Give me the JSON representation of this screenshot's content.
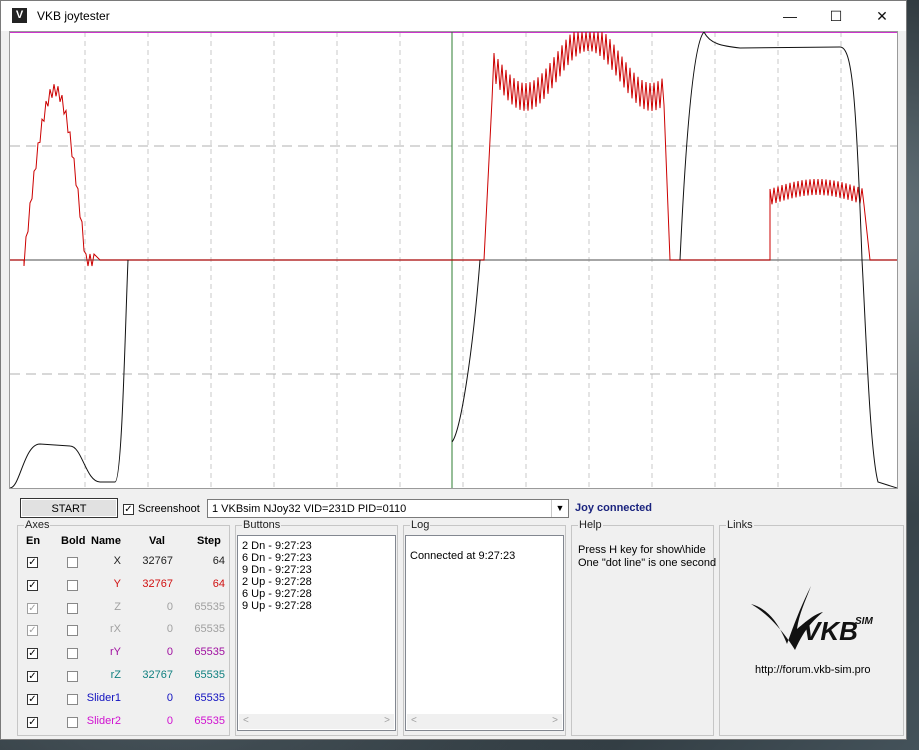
{
  "window": {
    "title": "VKB joytester",
    "minimize_glyph": "—",
    "maximize_glyph": "☐",
    "close_glyph": "✕",
    "icon": "vkb-logo-icon"
  },
  "toolbar": {
    "start_label": "START",
    "screenshot_label": "Screenshoot",
    "screenshot_checked": true,
    "device": "1 VKBsim NJoy32  VID=231D PID=0110",
    "status": "Joy connected",
    "status_color": "#1a237e"
  },
  "axes": {
    "group_title": "Axes",
    "headers": {
      "en": "En",
      "bold": "Bold",
      "name": "Name",
      "val": "Val",
      "step": "Step"
    },
    "rows": [
      {
        "name": "X",
        "val": "32767",
        "step": "64",
        "color": "#222222",
        "en": true,
        "en_dim": false,
        "bold": false
      },
      {
        "name": "Y",
        "val": "32767",
        "step": "64",
        "color": "#d01010",
        "en": true,
        "en_dim": false,
        "bold": false
      },
      {
        "name": "Z",
        "val": "0",
        "step": "65535",
        "color": "#a0a0a0",
        "en": true,
        "en_dim": true,
        "bold": false
      },
      {
        "name": "rX",
        "val": "0",
        "step": "65535",
        "color": "#a0a0a0",
        "en": true,
        "en_dim": true,
        "bold": false
      },
      {
        "name": "rY",
        "val": "0",
        "step": "65535",
        "color": "#a010a0",
        "en": true,
        "en_dim": false,
        "bold": false
      },
      {
        "name": "rZ",
        "val": "32767",
        "step": "65535",
        "color": "#108080",
        "en": true,
        "en_dim": false,
        "bold": false
      },
      {
        "name": "Slider1",
        "val": "0",
        "step": "65535",
        "color": "#1010c0",
        "en": true,
        "en_dim": false,
        "bold": false
      },
      {
        "name": "Slider2",
        "val": "0",
        "step": "65535",
        "color": "#d010d0",
        "en": true,
        "en_dim": false,
        "bold": false
      }
    ]
  },
  "buttons": {
    "group_title": "Buttons",
    "lines": [
      "2 Dn - 9:27:23",
      "6 Dn - 9:27:23",
      "9 Dn - 9:27:23",
      "2 Up - 9:27:28",
      "6 Up - 9:27:28",
      "9 Up - 9:27:28"
    ]
  },
  "log": {
    "group_title": "Log",
    "lines": [
      "Connected at 9:27:23"
    ]
  },
  "help": {
    "group_title": "Help",
    "lines": [
      "Press H key for show\\hide",
      "One \"dot line\" is one second"
    ]
  },
  "links": {
    "group_title": "Links",
    "logo_text": "VKB",
    "logo_sup": "SIM",
    "url": "http://forum.vkb-sim.pro"
  },
  "colors": {
    "x_trace": "#111111",
    "y_trace": "#cc0000",
    "top_line": "#cc33cc",
    "cursor": "#2e7d32"
  }
}
